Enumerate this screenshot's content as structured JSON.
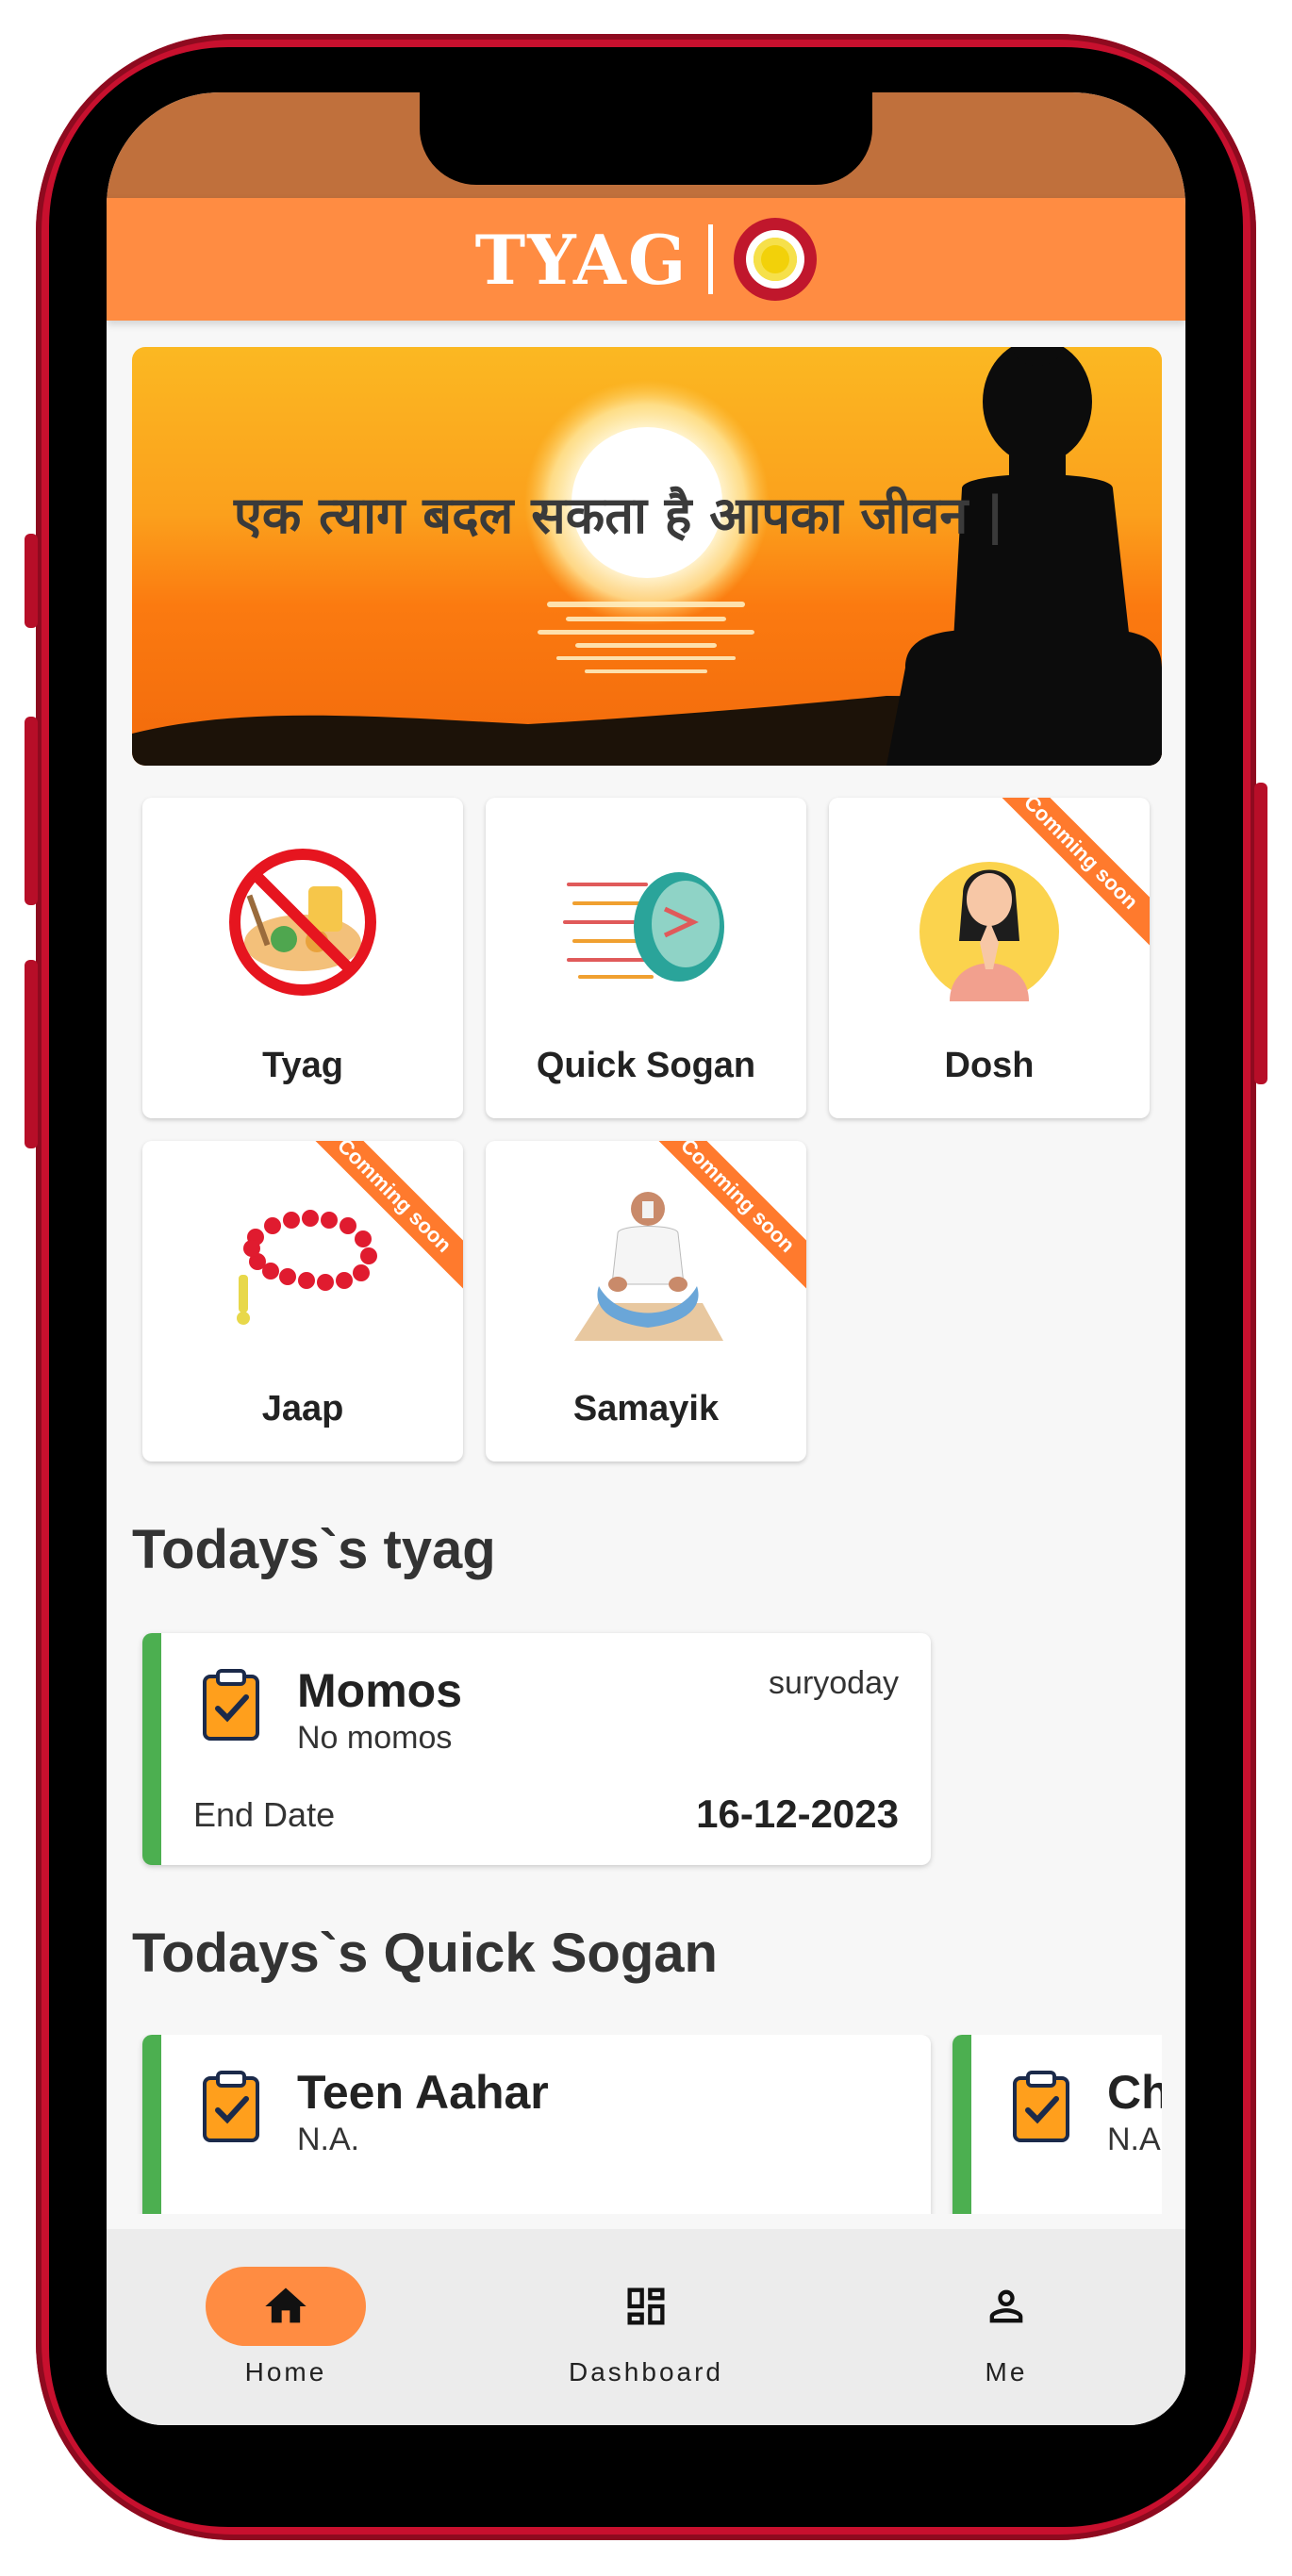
{
  "app": {
    "title": "TYAG",
    "accent_color": "#ff8c42",
    "status_bar_color": "#c0703c"
  },
  "banner": {
    "text": "एक त्याग बदल सकता है आपका जीवन |"
  },
  "tiles": [
    {
      "label": "Tyag",
      "icon": "no-food-icon",
      "badge": ""
    },
    {
      "label": "Quick Sogan",
      "icon": "quick-plate-icon",
      "badge": ""
    },
    {
      "label": "Dosh",
      "icon": "praying-woman-icon",
      "badge": "Comming soon"
    },
    {
      "label": "Jaap",
      "icon": "prayer-beads-icon",
      "badge": "Comming soon"
    },
    {
      "label": "Samayik",
      "icon": "meditation-icon",
      "badge": "Comming soon"
    }
  ],
  "todays_tyag": {
    "heading": "Todays`s tyag",
    "cards": [
      {
        "title": "Momos",
        "subtitle": "No momos",
        "time": "suryoday",
        "end_label": "End Date",
        "end_date": "16-12-2023"
      }
    ]
  },
  "todays_sogan": {
    "heading": "Todays`s Quick Sogan",
    "cards": [
      {
        "title": "Teen Aahar",
        "subtitle": "N.A."
      },
      {
        "title": "Ch",
        "subtitle": "N.A"
      }
    ]
  },
  "bottom_nav": {
    "items": [
      {
        "label": "Home",
        "icon": "home-icon",
        "active": true
      },
      {
        "label": "Dashboard",
        "icon": "dashboard-icon",
        "active": false
      },
      {
        "label": "Me",
        "icon": "person-icon",
        "active": false
      }
    ]
  }
}
